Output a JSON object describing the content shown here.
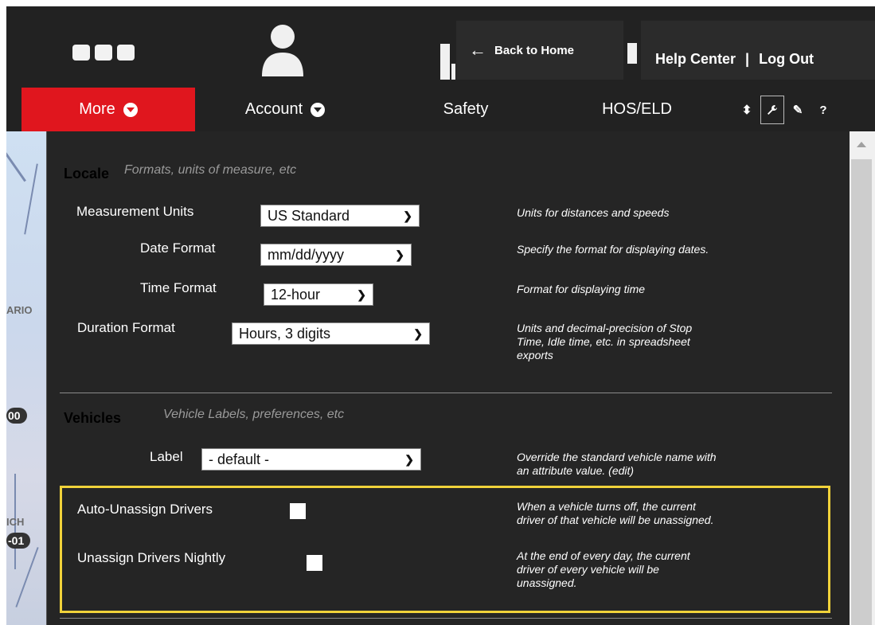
{
  "header": {
    "back_label": "Back to Home",
    "back_arrow": "←",
    "help_center": "Help Center",
    "separator": "|",
    "log_out": "Log Out"
  },
  "nav": {
    "more": "More",
    "account": "Account",
    "safety": "Safety",
    "hos": "HOS/ELD"
  },
  "tools": {
    "sort": "⬍",
    "wrench": "🔧",
    "pen": "✎",
    "help": "?"
  },
  "map": {
    "label_ario": "ARIO",
    "label_ich": "ICH",
    "badge_00": "00",
    "badge_01": "-01"
  },
  "locale": {
    "title": "Locale",
    "hint": "Formats, units of measure, etc",
    "measurement_label": "Measurement Units",
    "measurement_value": "US Standard",
    "measurement_desc": "Units for distances and speeds",
    "date_label": "Date Format",
    "date_value": "mm/dd/yyyy",
    "date_desc": "Specify the format for displaying dates.",
    "time_label": "Time Format",
    "time_value": "12-hour",
    "time_desc": "Format for displaying time",
    "duration_label": "Duration Format",
    "duration_value": "Hours, 3 digits",
    "duration_desc_1": "Units and decimal-precision of Stop",
    "duration_desc_2": "Time, Idle time, etc. in spreadsheet",
    "duration_desc_3": "exports"
  },
  "vehicles": {
    "title": "Vehicles",
    "hint": "Vehicle Labels, preferences, etc",
    "label_label": "Label",
    "label_value": "- default -",
    "label_desc_1": "Override the standard vehicle name with",
    "label_desc_2": "an attribute value. (edit)",
    "auto_unassign_label": "Auto-Unassign Drivers",
    "auto_unassign_desc_1": "When a vehicle turns off, the current",
    "auto_unassign_desc_2": "driver of that vehicle will be unassigned.",
    "nightly_label": "Unassign Drivers Nightly",
    "nightly_desc_1": "At the end of every day, the current",
    "nightly_desc_2": "driver of every vehicle will be",
    "nightly_desc_3": "unassigned."
  },
  "colors": {
    "header_bg": "#222222",
    "accent_red": "#e0161e",
    "highlight_yellow": "#f0d23a"
  }
}
